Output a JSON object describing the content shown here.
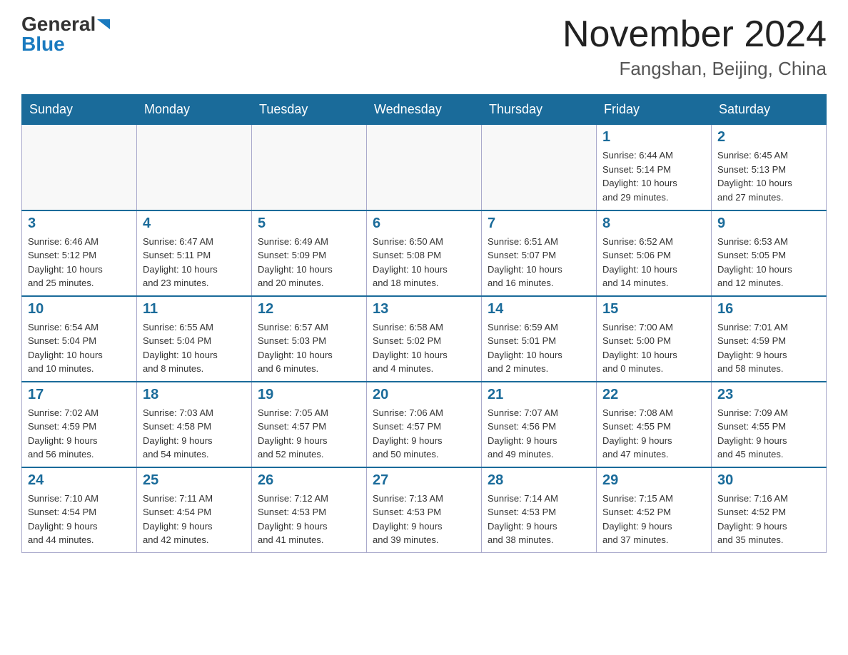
{
  "header": {
    "logo_general": "General",
    "logo_blue": "Blue",
    "month_title": "November 2024",
    "location": "Fangshan, Beijing, China"
  },
  "weekdays": [
    "Sunday",
    "Monday",
    "Tuesday",
    "Wednesday",
    "Thursday",
    "Friday",
    "Saturday"
  ],
  "weeks": [
    [
      {
        "day": "",
        "info": ""
      },
      {
        "day": "",
        "info": ""
      },
      {
        "day": "",
        "info": ""
      },
      {
        "day": "",
        "info": ""
      },
      {
        "day": "",
        "info": ""
      },
      {
        "day": "1",
        "info": "Sunrise: 6:44 AM\nSunset: 5:14 PM\nDaylight: 10 hours\nand 29 minutes."
      },
      {
        "day": "2",
        "info": "Sunrise: 6:45 AM\nSunset: 5:13 PM\nDaylight: 10 hours\nand 27 minutes."
      }
    ],
    [
      {
        "day": "3",
        "info": "Sunrise: 6:46 AM\nSunset: 5:12 PM\nDaylight: 10 hours\nand 25 minutes."
      },
      {
        "day": "4",
        "info": "Sunrise: 6:47 AM\nSunset: 5:11 PM\nDaylight: 10 hours\nand 23 minutes."
      },
      {
        "day": "5",
        "info": "Sunrise: 6:49 AM\nSunset: 5:09 PM\nDaylight: 10 hours\nand 20 minutes."
      },
      {
        "day": "6",
        "info": "Sunrise: 6:50 AM\nSunset: 5:08 PM\nDaylight: 10 hours\nand 18 minutes."
      },
      {
        "day": "7",
        "info": "Sunrise: 6:51 AM\nSunset: 5:07 PM\nDaylight: 10 hours\nand 16 minutes."
      },
      {
        "day": "8",
        "info": "Sunrise: 6:52 AM\nSunset: 5:06 PM\nDaylight: 10 hours\nand 14 minutes."
      },
      {
        "day": "9",
        "info": "Sunrise: 6:53 AM\nSunset: 5:05 PM\nDaylight: 10 hours\nand 12 minutes."
      }
    ],
    [
      {
        "day": "10",
        "info": "Sunrise: 6:54 AM\nSunset: 5:04 PM\nDaylight: 10 hours\nand 10 minutes."
      },
      {
        "day": "11",
        "info": "Sunrise: 6:55 AM\nSunset: 5:04 PM\nDaylight: 10 hours\nand 8 minutes."
      },
      {
        "day": "12",
        "info": "Sunrise: 6:57 AM\nSunset: 5:03 PM\nDaylight: 10 hours\nand 6 minutes."
      },
      {
        "day": "13",
        "info": "Sunrise: 6:58 AM\nSunset: 5:02 PM\nDaylight: 10 hours\nand 4 minutes."
      },
      {
        "day": "14",
        "info": "Sunrise: 6:59 AM\nSunset: 5:01 PM\nDaylight: 10 hours\nand 2 minutes."
      },
      {
        "day": "15",
        "info": "Sunrise: 7:00 AM\nSunset: 5:00 PM\nDaylight: 10 hours\nand 0 minutes."
      },
      {
        "day": "16",
        "info": "Sunrise: 7:01 AM\nSunset: 4:59 PM\nDaylight: 9 hours\nand 58 minutes."
      }
    ],
    [
      {
        "day": "17",
        "info": "Sunrise: 7:02 AM\nSunset: 4:59 PM\nDaylight: 9 hours\nand 56 minutes."
      },
      {
        "day": "18",
        "info": "Sunrise: 7:03 AM\nSunset: 4:58 PM\nDaylight: 9 hours\nand 54 minutes."
      },
      {
        "day": "19",
        "info": "Sunrise: 7:05 AM\nSunset: 4:57 PM\nDaylight: 9 hours\nand 52 minutes."
      },
      {
        "day": "20",
        "info": "Sunrise: 7:06 AM\nSunset: 4:57 PM\nDaylight: 9 hours\nand 50 minutes."
      },
      {
        "day": "21",
        "info": "Sunrise: 7:07 AM\nSunset: 4:56 PM\nDaylight: 9 hours\nand 49 minutes."
      },
      {
        "day": "22",
        "info": "Sunrise: 7:08 AM\nSunset: 4:55 PM\nDaylight: 9 hours\nand 47 minutes."
      },
      {
        "day": "23",
        "info": "Sunrise: 7:09 AM\nSunset: 4:55 PM\nDaylight: 9 hours\nand 45 minutes."
      }
    ],
    [
      {
        "day": "24",
        "info": "Sunrise: 7:10 AM\nSunset: 4:54 PM\nDaylight: 9 hours\nand 44 minutes."
      },
      {
        "day": "25",
        "info": "Sunrise: 7:11 AM\nSunset: 4:54 PM\nDaylight: 9 hours\nand 42 minutes."
      },
      {
        "day": "26",
        "info": "Sunrise: 7:12 AM\nSunset: 4:53 PM\nDaylight: 9 hours\nand 41 minutes."
      },
      {
        "day": "27",
        "info": "Sunrise: 7:13 AM\nSunset: 4:53 PM\nDaylight: 9 hours\nand 39 minutes."
      },
      {
        "day": "28",
        "info": "Sunrise: 7:14 AM\nSunset: 4:53 PM\nDaylight: 9 hours\nand 38 minutes."
      },
      {
        "day": "29",
        "info": "Sunrise: 7:15 AM\nSunset: 4:52 PM\nDaylight: 9 hours\nand 37 minutes."
      },
      {
        "day": "30",
        "info": "Sunrise: 7:16 AM\nSunset: 4:52 PM\nDaylight: 9 hours\nand 35 minutes."
      }
    ]
  ]
}
